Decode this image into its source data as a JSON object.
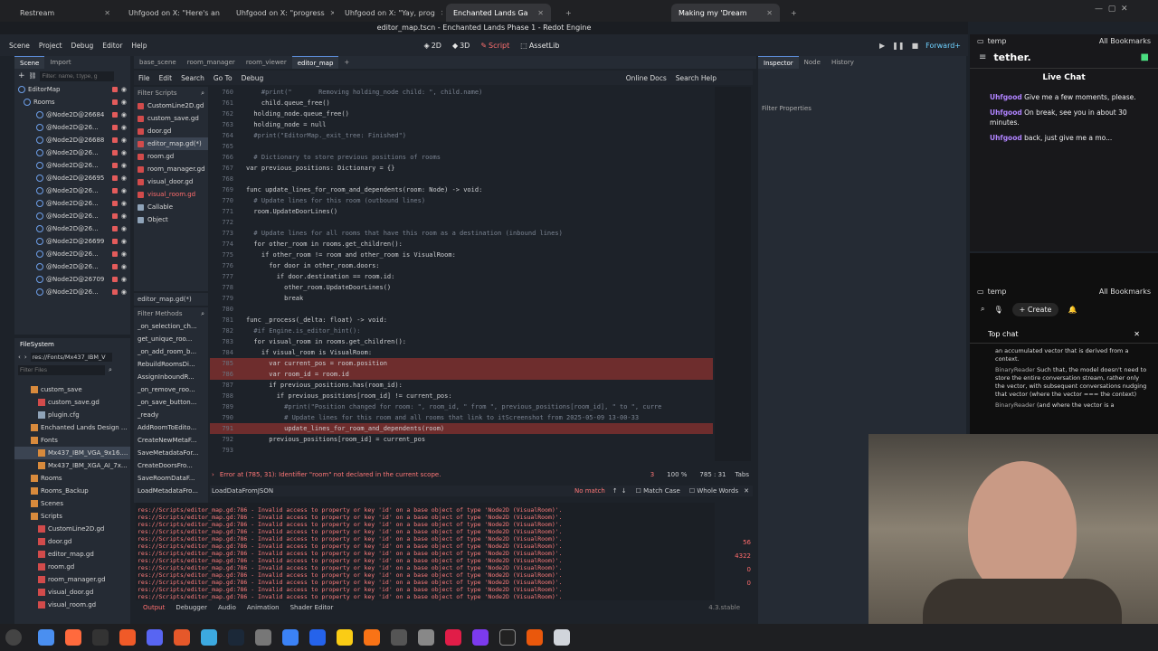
{
  "browser": {
    "tabs": [
      {
        "label": "Restream"
      },
      {
        "label": "Uhfgood on X: \"Here's an"
      },
      {
        "label": "Uhfgood on X: \"progress"
      },
      {
        "label": "Uhfgood on X: \"Yay, prog"
      },
      {
        "label": "Enchanted Lands Ga"
      },
      {
        "label": "Making my 'Dream"
      }
    ]
  },
  "godot": {
    "title": "editor_map.tscn - Enchanted Lands Phase 1 - Redot Engine",
    "menu": [
      "Scene",
      "Project",
      "Debug",
      "Editor",
      "Help"
    ],
    "workspaces": [
      "2D",
      "3D",
      "Script",
      "AssetLib"
    ],
    "renderer": "Forward+",
    "scene_tabs": [
      "Scene",
      "Import"
    ],
    "filter_nodes_placeholder": "Filter: name, t:type, g",
    "scene_tree": [
      "EditorMap",
      "Rooms",
      "@Node2D@26684",
      "@Node2D@26...",
      "@Node2D@26688",
      "@Node2D@26...",
      "@Node2D@26...",
      "@Node2D@26695",
      "@Node2D@26...",
      "@Node2D@26...",
      "@Node2D@26...",
      "@Node2D@26...",
      "@Node2D@26699",
      "@Node2D@26...",
      "@Node2D@26...",
      "@Node2D@26709",
      "@Node2D@26..."
    ],
    "filesystem": {
      "title": "FileSystem",
      "path": "res://Fonts/Mx437_IBM_V",
      "filter_placeholder": "Filter Files",
      "items": [
        "custom_save",
        "custom_save.gd",
        "plugin.cfg",
        "Enchanted Lands Design ...",
        "Fonts",
        "Mx437_IBM_VGA_9x16....",
        "Mx437_IBM_XGA_AI_7x...",
        "Rooms",
        "Rooms_Backup",
        "Scenes",
        "Scripts",
        "CustomLine2D.gd",
        "door.gd",
        "editor_map.gd",
        "room.gd",
        "room_manager.gd",
        "visual_door.gd",
        "visual_room.gd"
      ]
    },
    "editor_tabs": [
      "base_scene",
      "room_manager",
      "room_viewer",
      "editor_map"
    ],
    "script_menu": [
      "File",
      "Edit",
      "Search",
      "Go To",
      "Debug"
    ],
    "online_docs": "Online Docs",
    "search_help": "Search Help",
    "filter_scripts_placeholder": "Filter Scripts",
    "scripts": [
      "CustomLine2D.gd",
      "custom_save.gd",
      "door.gd",
      "editor_map.gd(*)",
      "room.gd",
      "room_manager.gd",
      "visual_door.gd",
      "visual_room.gd",
      "Callable",
      "Object"
    ],
    "current_script": "editor_map.gd(*)",
    "filter_methods_placeholder": "Filter Methods",
    "methods": [
      "_on_selection_ch...",
      "get_unique_roo...",
      "_on_add_room_b...",
      "RebuildRoomsDi...",
      "AssignInboundR...",
      "_on_remove_roo...",
      "_on_save_button...",
      "_ready",
      "AddRoomToEdito...",
      "CreateNewMetaF...",
      "SaveMetadataFor...",
      "CreateDoorsFro...",
      "SaveRoomDataF...",
      "LoadMetadataFro..."
    ],
    "code_lines": [
      {
        "n": "760",
        "t": "    #print(\"       Removing holding_node child: \", child.name)"
      },
      {
        "n": "761",
        "t": "    child.queue_free()"
      },
      {
        "n": "762",
        "t": "  holding_node.queue_free()"
      },
      {
        "n": "763",
        "t": "  holding_node = null"
      },
      {
        "n": "764",
        "t": "  #print(\"EditorMap._exit_tree: Finished\")"
      },
      {
        "n": "765",
        "t": ""
      },
      {
        "n": "766",
        "t": "  # Dictionary to store previous positions of rooms"
      },
      {
        "n": "767",
        "t": "var previous_positions: Dictionary = {}"
      },
      {
        "n": "768",
        "t": ""
      },
      {
        "n": "769",
        "t": "func update_lines_for_room_and_dependents(room: Node) -> void:"
      },
      {
        "n": "770",
        "t": "  # Update lines for this room (outbound lines)"
      },
      {
        "n": "771",
        "t": "  room.UpdateDoorLines()"
      },
      {
        "n": "772",
        "t": ""
      },
      {
        "n": "773",
        "t": "  # Update lines for all rooms that have this room as a destination (inbound lines)"
      },
      {
        "n": "774",
        "t": "  for other_room in rooms.get_children():"
      },
      {
        "n": "775",
        "t": "    if other_room != room and other_room is VisualRoom:"
      },
      {
        "n": "776",
        "t": "      for door in other_room.doors:"
      },
      {
        "n": "777",
        "t": "        if door.destination == room.id:"
      },
      {
        "n": "778",
        "t": "          other_room.UpdateDoorLines()"
      },
      {
        "n": "779",
        "t": "          break"
      },
      {
        "n": "780",
        "t": ""
      },
      {
        "n": "781",
        "t": "func _process(_delta: float) -> void:"
      },
      {
        "n": "782",
        "t": "  #if Engine.is_editor_hint():"
      },
      {
        "n": "783",
        "t": "  for visual_room in rooms.get_children():"
      },
      {
        "n": "784",
        "t": "    if visual_room is VisualRoom:"
      },
      {
        "n": "785",
        "t": "      var current_pos = room.position"
      },
      {
        "n": "786",
        "t": "      var room_id = room.id"
      },
      {
        "n": "787",
        "t": "      if previous_positions.has(room_id):"
      },
      {
        "n": "788",
        "t": "        if previous_positions[room_id] != current_pos:"
      },
      {
        "n": "789",
        "t": "          #print(\"Position changed for room: \", room_id, \" from \", previous_positions[room_id], \" to \", curre"
      },
      {
        "n": "790",
        "t": "          # Update lines for this room and all rooms that link to itScreenshot from 2025-05-09 13-00-33"
      },
      {
        "n": "791",
        "t": "          update_lines_for_room_and_dependents(room)"
      },
      {
        "n": "792",
        "t": "      previous_positions[room_id] = current_pos"
      },
      {
        "n": "793",
        "t": ""
      }
    ],
    "error_text": "Error at (785, 31): Identifier \"room\" not declared in the current scope.",
    "error_count": "3",
    "zoom": "100 %",
    "line_col": "785 :  31",
    "indent": "Tabs",
    "find_text": "LoadDataFromJSON",
    "find_status": "No match",
    "match_case": "Match Case",
    "whole_words": "Whole Words",
    "output_lines": [
      "res://Scripts/editor_map.gd:786 - Invalid access to property or key 'id' on a base object of type 'Node2D (VisualRoom)'.",
      "res://Scripts/editor_map.gd:786 - Invalid access to property or key 'id' on a base object of type 'Node2D (VisualRoom)'.",
      "res://Scripts/editor_map.gd:786 - Invalid access to property or key 'id' on a base object of type 'Node2D (VisualRoom)'.",
      "res://Scripts/editor_map.gd:786 - Invalid access to property or key 'id' on a base object of type 'Node2D (VisualRoom)'.",
      "res://Scripts/editor_map.gd:786 - Invalid access to property or key 'id' on a base object of type 'Node2D (VisualRoom)'.",
      "res://Scripts/editor_map.gd:786 - Invalid access to property or key 'id' on a base object of type 'Node2D (VisualRoom)'.",
      "res://Scripts/editor_map.gd:786 - Invalid access to property or key 'id' on a base object of type 'Node2D (VisualRoom)'.",
      "res://Scripts/editor_map.gd:786 - Invalid access to property or key 'id' on a base object of type 'Node2D (VisualRoom)'.",
      "res://Scripts/editor_map.gd:786 - Invalid access to property or key 'id' on a base object of type 'Node2D (VisualRoom)'.",
      "res://Scripts/editor_map.gd:786 - Invalid access to property or key 'id' on a base object of type 'Node2D (VisualRoom)'.",
      "res://Scripts/editor_map.gd:786 - Invalid access to property or key 'id' on a base object of type 'Node2D (VisualRoom)'.",
      "res://Scripts/editor_map.gd:786 - Invalid access to property or key 'id' on a base object of type 'Node2D (VisualRoom)'.",
      "res://Scripts/editor_map.gd:786 - Invalid access to property or key 'id' on a base object of type 'Node2D (VisualRoom)'.",
      "res://Scripts/editor_map.gd:786 - Invalid access to property or key 'id' on a base object of type 'Node2D (VisualRoom)'."
    ],
    "output_counts": {
      "errors": "56",
      "warnings": "4322",
      "w2": "0",
      "i": "0"
    },
    "bottom_tabs": [
      "Output",
      "Debugger",
      "Audio",
      "Animation",
      "Shader Editor"
    ],
    "version": "4.3.stable",
    "inspector_tabs": [
      "Inspector",
      "Node",
      "History"
    ],
    "filter_properties": "Filter Properties"
  },
  "chat": {
    "app": "tether.",
    "title": "Live Chat",
    "messages": [
      {
        "user": "Uhfgood",
        "text": "Give me a few moments, please."
      },
      {
        "user": "Uhfgood",
        "text": "On break, see you in about 30 minutes."
      },
      {
        "user": "Uhfgood",
        "text": "back, just give me a mo..."
      }
    ],
    "bookmarks": "All Bookmarks",
    "folder": "temp"
  },
  "yt": {
    "create": "Create",
    "top_chat": "Top chat",
    "messages": [
      {
        "text": "an accumulated vector that is derived from a context."
      },
      {
        "user": "BinaryReader",
        "text": "Such that, the model doesn't need to store the entire conversation stream, rather only the vector, with subsequent conversations nudging that vector (where the vector === the context)"
      },
      {
        "user": "BinaryReader",
        "text": "(and where the vector is a"
      }
    ]
  }
}
